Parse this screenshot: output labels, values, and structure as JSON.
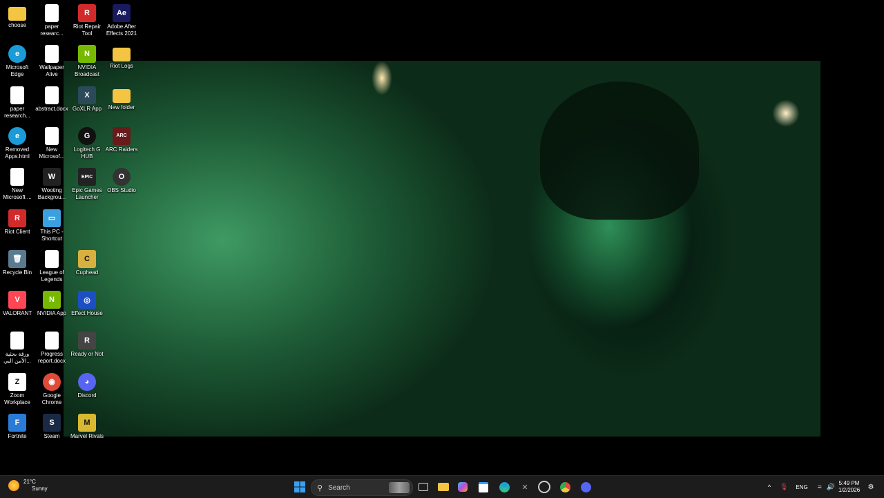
{
  "desktop": {
    "icons": [
      {
        "label": "choose",
        "glyph": "",
        "color": "#f4c542"
      },
      {
        "label": "paper researc...",
        "glyph": "",
        "color": "#fff"
      },
      {
        "label": "Riot Repair Tool",
        "glyph": "R",
        "color": "#d12a2a"
      },
      {
        "label": "Adobe After Effects 2021",
        "glyph": "Ae",
        "color": "#1a1a5e"
      },
      {
        "label": "Microsoft Edge",
        "glyph": "e",
        "color": "#1b9bd7"
      },
      {
        "label": "Wallpaper Alive",
        "glyph": "",
        "color": "#fff"
      },
      {
        "label": "NVIDIA Broadcast",
        "glyph": "N",
        "color": "#76b900"
      },
      {
        "label": "Riot Logs",
        "glyph": "",
        "color": "#f4c542"
      },
      {
        "label": "paper research...",
        "glyph": "",
        "color": "#fff"
      },
      {
        "label": "abstract.docx",
        "glyph": "",
        "color": "#fff"
      },
      {
        "label": "GoXLR App",
        "glyph": "X",
        "color": "#2a4a5a"
      },
      {
        "label": "New folder",
        "glyph": "",
        "color": "#f4c542"
      },
      {
        "label": "Removed Apps.html",
        "glyph": "e",
        "color": "#1b9bd7"
      },
      {
        "label": "New Microsof...",
        "glyph": "",
        "color": "#fff"
      },
      {
        "label": "Logitech G HUB",
        "glyph": "G",
        "color": "#111"
      },
      {
        "label": "ARC Raiders",
        "glyph": "ARC",
        "color": "#6a1a1a"
      },
      {
        "label": "New Microsoft ...",
        "glyph": "",
        "color": "#fff"
      },
      {
        "label": "Wooting Backgrou...",
        "glyph": "W",
        "color": "#222"
      },
      {
        "label": "Epic Games Launcher",
        "glyph": "EPIC",
        "color": "#222"
      },
      {
        "label": "OBS Studio",
        "glyph": "O",
        "color": "#333"
      },
      {
        "label": "Riot Client",
        "glyph": "R",
        "color": "#d12a2a"
      },
      {
        "label": "This PC - Shortcut",
        "glyph": "▭",
        "color": "#3aa0e0"
      },
      {
        "label": "Recycle Bin",
        "glyph": "🗑",
        "color": "#5a7a90"
      },
      {
        "label": "League of Legends",
        "glyph": "",
        "color": "#fff"
      },
      {
        "label": "Cuphead",
        "glyph": "C",
        "color": "#d8b040"
      },
      {
        "label": "VALORANT",
        "glyph": "V",
        "color": "#ff4655"
      },
      {
        "label": "NVIDIA App",
        "glyph": "N",
        "color": "#76b900"
      },
      {
        "label": "Effect House",
        "glyph": "◎",
        "color": "#1d4fc4"
      },
      {
        "label": "ورقة بحثية الأمن البي...",
        "glyph": "",
        "color": "#fff"
      },
      {
        "label": "Progress report.docx",
        "glyph": "",
        "color": "#fff"
      },
      {
        "label": "Ready or Not",
        "glyph": "R",
        "color": "#444"
      },
      {
        "label": "Zoom Workplace",
        "glyph": "Z",
        "color": "#fff"
      },
      {
        "label": "Google Chrome",
        "glyph": "◉",
        "color": "#e04a3a"
      },
      {
        "label": "Discord",
        "glyph": "◕",
        "color": "#5865f2"
      },
      {
        "label": "Fortnite",
        "glyph": "F",
        "color": "#2a7ad8"
      },
      {
        "label": "Steam",
        "glyph": "S",
        "color": "#1a2a44"
      },
      {
        "label": "Marvel Rivals",
        "glyph": "M",
        "color": "#d8b830"
      }
    ]
  },
  "taskbar": {
    "weather_temp": "21°C",
    "weather_cond": "Sunny",
    "search_placeholder": "Search",
    "language": "ENG",
    "time": "5:49 PM",
    "date": "1/2/2026"
  }
}
